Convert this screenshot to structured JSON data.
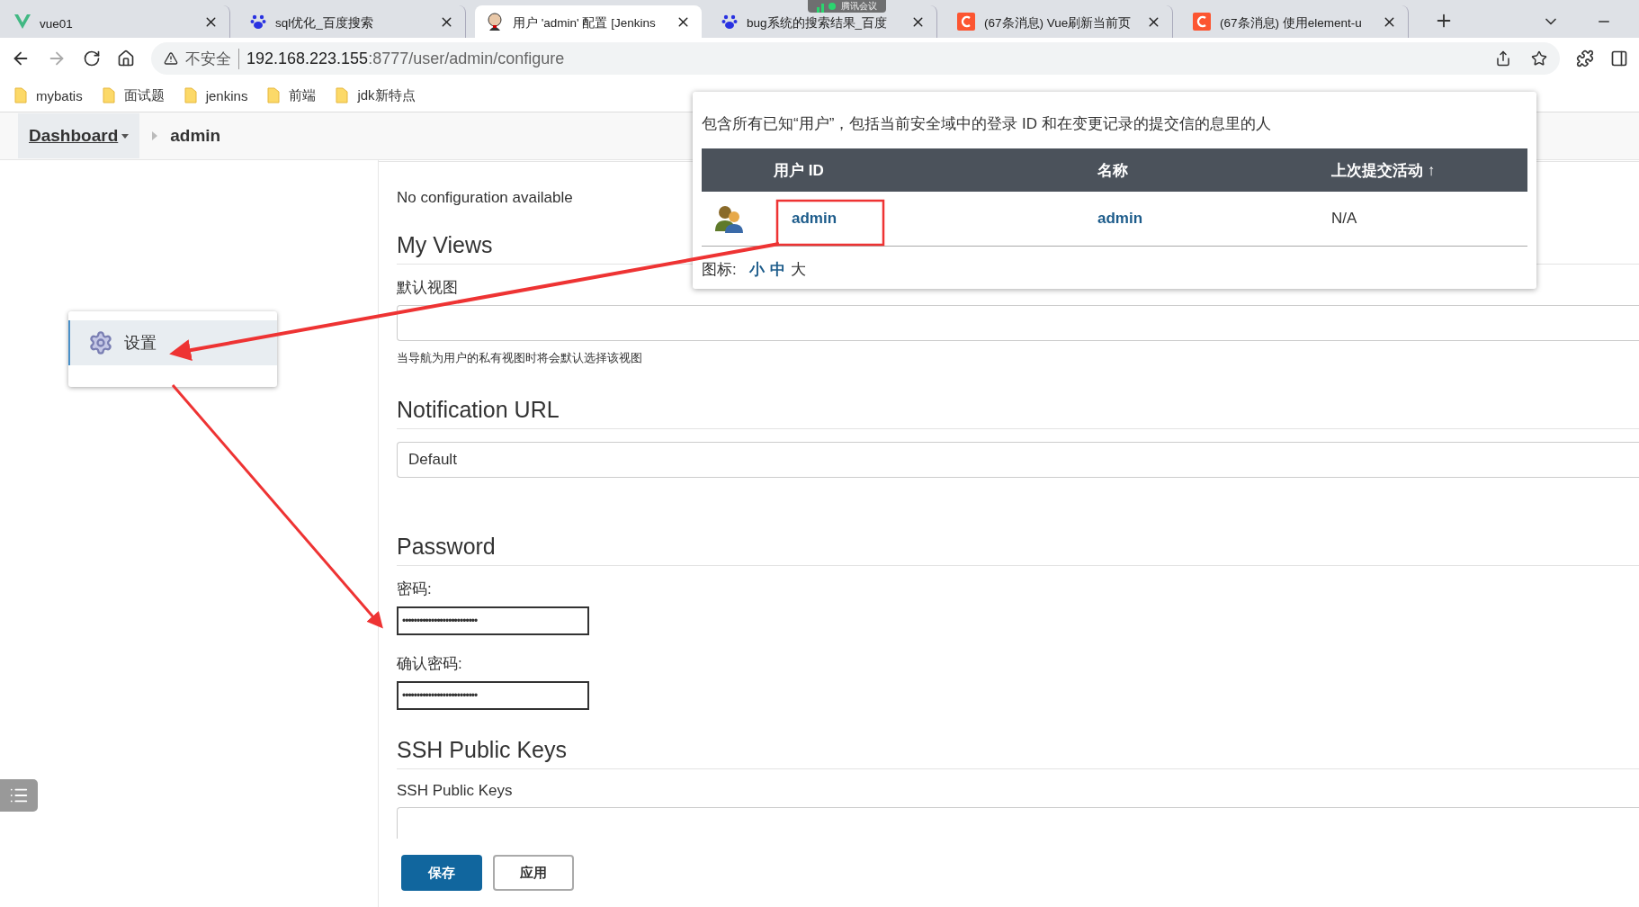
{
  "browser": {
    "tabs": [
      {
        "title": "vue01",
        "kind": "vue",
        "selected": false
      },
      {
        "title": "sql优化_百度搜索",
        "kind": "baidu",
        "selected": false
      },
      {
        "title": "用户 'admin' 配置 [Jenkins",
        "kind": "jenkins",
        "selected": true
      },
      {
        "title": "bug系统的搜索结果_百度",
        "kind": "baidu",
        "selected": false
      },
      {
        "title": "(67条消息) Vue刷新当前页",
        "kind": "csdn",
        "selected": false
      },
      {
        "title": "(67条消息) 使用element-u",
        "kind": "csdn",
        "selected": false
      }
    ],
    "meeting_badge": "腾讯会议",
    "address": {
      "security": "不安全",
      "host": "192.168.223.155",
      "path": ":8777/user/admin/configure"
    },
    "bookmarks": [
      "mybatis",
      "面试题",
      "jenkins",
      "前端",
      "jdk新特点"
    ]
  },
  "breadcrumb": [
    {
      "label": "Dashboard",
      "has_menu": true
    },
    {
      "label": "admin",
      "has_menu": false
    }
  ],
  "side_menu": {
    "items": [
      {
        "label": "设置",
        "selected": true
      }
    ]
  },
  "form": {
    "no_config": "No configuration available",
    "my_views": {
      "heading": "My Views",
      "label": "默认视图",
      "hint": "当导航为用户的私有视图时将会默认选择该视图"
    },
    "notification": {
      "heading": "Notification URL",
      "value": "Default"
    },
    "password": {
      "heading": "Password",
      "password_label": "密码:",
      "password_value": "••••••••••••••••••••••••••",
      "confirm_label": "确认密码:",
      "confirm_value": "••••••••••••••••••••••••••"
    },
    "ssh": {
      "heading": "SSH Public Keys",
      "label": "SSH Public Keys"
    },
    "buttons": [
      {
        "label": "保存",
        "kind": "primary"
      },
      {
        "label": "应用",
        "kind": "secondary"
      }
    ]
  },
  "users_popup": {
    "description": "包含所有已知“用户”，包括当前安全域中的登录 ID 和在变更记录的提交信的息里的人",
    "columns": [
      "用户 ID",
      "名称",
      "上次提交活动 ↑"
    ],
    "rows": [
      {
        "user_id": "admin",
        "name": "admin",
        "last_activity": "N/A"
      }
    ],
    "icon_size_label": "图标:",
    "icon_sizes": [
      {
        "label": "小",
        "selected": false
      },
      {
        "label": "中",
        "selected": false
      },
      {
        "label": "大",
        "selected": true
      }
    ]
  }
}
